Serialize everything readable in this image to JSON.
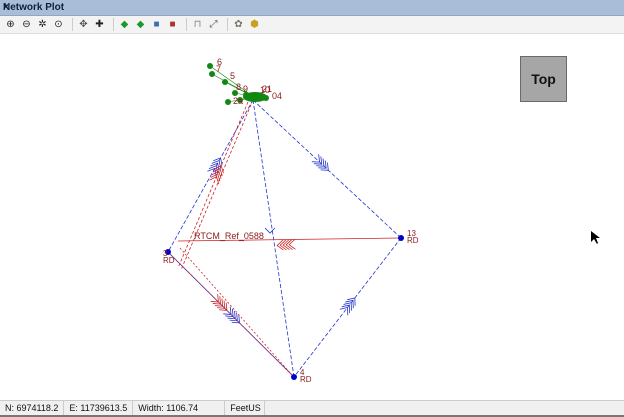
{
  "window": {
    "title": "Network Plot",
    "close": "×"
  },
  "toolbar": {
    "icons": [
      "zoom-in",
      "zoom-out",
      "zoom-extents",
      "zoom-previous",
      "pan",
      "crosshair",
      "add-point",
      "remove-point",
      "block",
      "block-delete",
      "tie-point",
      "measure",
      "settings",
      "layers"
    ],
    "glyphs": [
      "⊕",
      "⊖",
      "✲",
      "⊙",
      "✥",
      "✚",
      "◆",
      "◆",
      "■",
      "■",
      "⊓",
      "⤢",
      "✿",
      "⬢"
    ]
  },
  "view": {
    "button": "Top"
  },
  "plot": {
    "nodes": [
      {
        "id": "3",
        "sub": "RD"
      },
      {
        "id": "13",
        "sub": "RD"
      },
      {
        "id": "4",
        "sub": "RD"
      }
    ],
    "cluster_labels": [
      "6",
      "7",
      "5",
      "8",
      "9",
      "10",
      "21",
      "2a",
      "04"
    ],
    "edge_label": "RTCM_Ref_0588",
    "colors": {
      "gps": "#2233cc",
      "rtk": "#cc2222",
      "node": "#0000cc",
      "cluster": "#118811",
      "label": "#8b1a1a"
    }
  },
  "status": {
    "north": "N: 6974118.2",
    "east": "E: 11739613.5",
    "width": "Width: 1106.74",
    "units": "FeetUS"
  }
}
